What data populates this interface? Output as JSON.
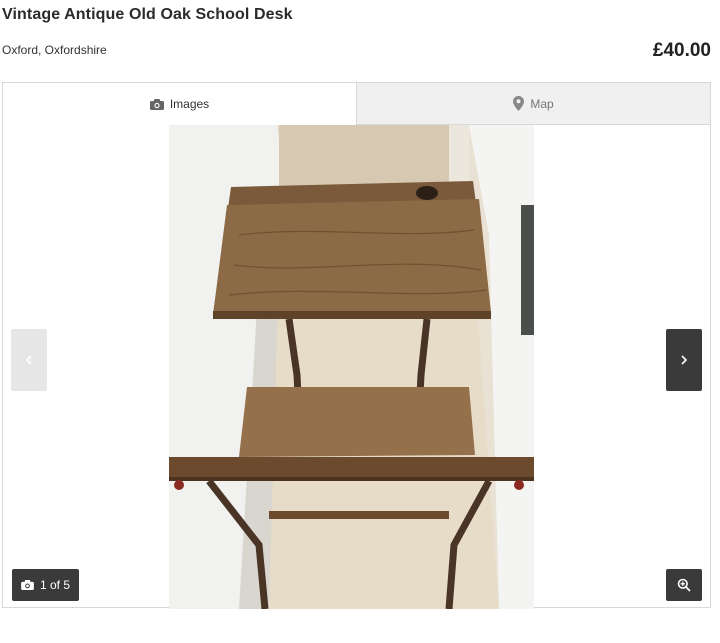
{
  "listing": {
    "title": "Vintage Antique Old Oak School Desk",
    "location": "Oxford, Oxfordshire",
    "price": "£40.00"
  },
  "gallery": {
    "tabs": [
      {
        "label": "Images",
        "icon": "camera-icon",
        "active": true
      },
      {
        "label": "Map",
        "icon": "map-pin-icon",
        "active": false
      }
    ],
    "counter": "1 of 5",
    "prev_icon": "chevron-left-icon",
    "next_icon": "chevron-right-icon",
    "zoom_icon": "zoom-in-icon",
    "photo_subject": "wooden school desk with attached bench seat on beige carpet"
  },
  "colors": {
    "active_tab_bg": "#ffffff",
    "inactive_tab_bg": "#f0f0f0",
    "dark_control": "#3a3a3a",
    "disabled_control": "#e6e6e6"
  }
}
